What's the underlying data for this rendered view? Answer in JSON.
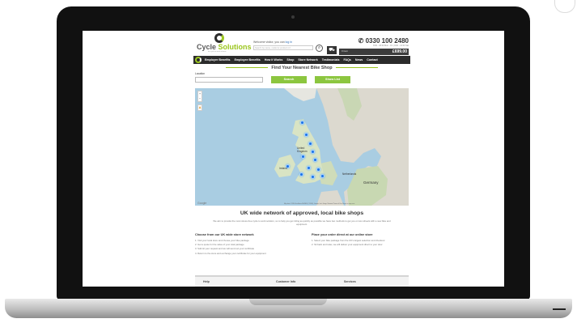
{
  "header": {
    "logo_text_a": "Cycle ",
    "logo_text_b": "Solutions",
    "logo_sub": "the cycle to work scheme",
    "welcome_prefix": "Welcome visitor, you can ",
    "welcome_link": "log in",
    "search_placeholder": "Search by name, model or product ref",
    "phone": "0330 100 2480",
    "hours": "8:00 - 18:00 Mon - Fri | 9:00 - 13:00 Sat",
    "basket_items": "0 item",
    "basket_total": "£699.00"
  },
  "nav": {
    "items": [
      "Employer Benefits",
      "Employee Benefits",
      "How it Works",
      "Shop",
      "Store Network",
      "Testimonials",
      "FAQs",
      "News",
      "Contact"
    ]
  },
  "finder": {
    "title": "Find Your Nearest Bike Shop",
    "location_label": "Location",
    "search_button": "Search",
    "list_button": "Show List"
  },
  "map": {
    "label_uk": "United Kingdom",
    "label_ireland": "Ireland",
    "label_germany": "Germany",
    "label_netherlands": "Netherlands",
    "footer": "Map data ©2016 GeoBasis-DE/BKG (©2009), Google, Inst. Geogr. Nacional Terms of Use Report a map error",
    "google": "Google",
    "zoom_in": "+",
    "zoom_out": "−"
  },
  "network": {
    "title": "UK wide network of approved, local bike shops",
    "intro": "We aim to provide the most stress-free cycle to work solution, so to help you get riding as quickly as possible we have two methods to get you on two wheels with a new bike and equipment."
  },
  "store_column": {
    "title": "Choose from our UK wide store network",
    "steps": [
      "1. Visit your local store and choose your bike package",
      "2. Get a quote for the value of your total package",
      "3. Submit your request and we will send out your certificate",
      "4. Return to the store and exchange your certificate for your equipment"
    ]
  },
  "online_column": {
    "title": "Place your order direct at our online store",
    "steps": [
      "1. Select your bike package from the UK's largest selection and checkout",
      "2. Sit back and relax, we will deliver your equipment direct to your door"
    ]
  },
  "footer": {
    "col1": "Help",
    "col2": "Customer Info",
    "col3": "Services"
  },
  "colors": {
    "accent": "#8cc63f",
    "nav_bg": "#2b2b2b",
    "map_water": "#a9cde2",
    "pin": "#1a73e8"
  }
}
